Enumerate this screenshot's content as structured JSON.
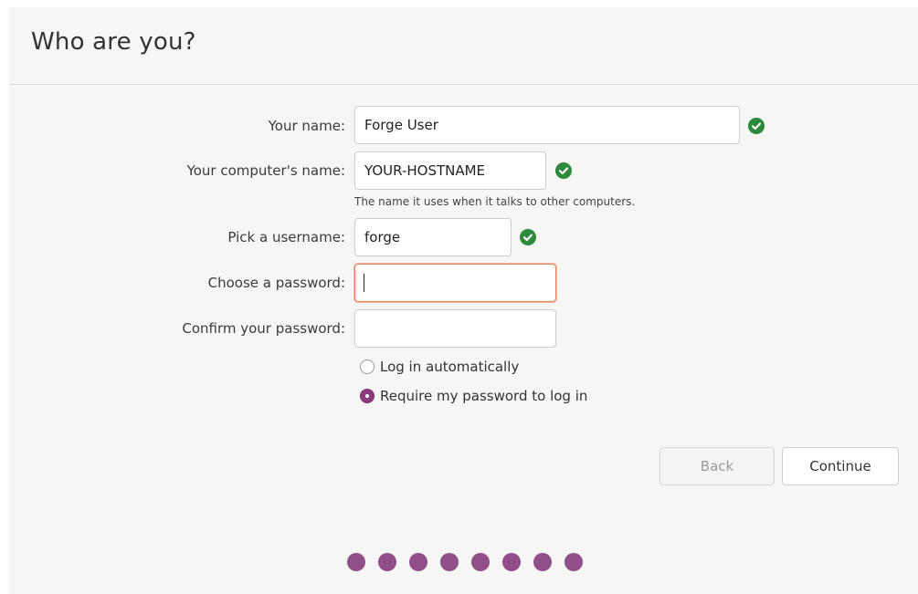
{
  "header": {
    "title": "Who are you?"
  },
  "form": {
    "name": {
      "label": "Your name:",
      "value": "Forge User"
    },
    "computer_name": {
      "label": "Your computer's name:",
      "value": "YOUR-HOSTNAME",
      "hint": "The name it uses when it talks to other computers."
    },
    "username": {
      "label": "Pick a username:",
      "value": "forge"
    },
    "password": {
      "label": "Choose a password:",
      "value": ""
    },
    "confirm_password": {
      "label": "Confirm your password:",
      "value": ""
    },
    "login_options": [
      {
        "label": "Log in automatically",
        "selected": false
      },
      {
        "label": "Require my password to log in",
        "selected": true
      }
    ]
  },
  "buttons": {
    "back": "Back",
    "continue": "Continue"
  },
  "progress": {
    "total_steps": 8
  },
  "colors": {
    "accent": "#924d8b",
    "valid": "#2d8a3a",
    "focus_border": "#e9835f"
  }
}
